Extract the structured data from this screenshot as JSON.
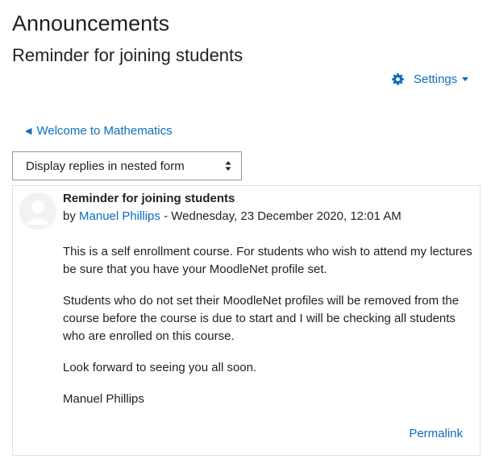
{
  "page": {
    "title": "Announcements",
    "discussion_title": "Reminder for joining students"
  },
  "settings_menu": {
    "label": "Settings",
    "icon": "gear-icon",
    "accent_color": "#0f6cbf"
  },
  "navigation": {
    "back_link_label": "Welcome to Mathematics"
  },
  "display_mode": {
    "selected": "Display replies in nested form"
  },
  "post": {
    "subject": "Reminder for joining students",
    "by_prefix": "by",
    "author": "Manuel Phillips",
    "date_separator": " - ",
    "date": "Wednesday, 23 December 2020, 12:01 AM",
    "paragraphs": [
      "This is a self enrollment course. For students who wish to attend my lectures be sure that you have your MoodleNet profile set.",
      "Students who do not set their MoodleNet profiles will be  removed from the course before the course is due to start and I will be checking all students who are enrolled on this course.",
      "Look forward to seeing you all soon.",
      "Manuel Phillips"
    ],
    "permalink_label": "Permalink"
  }
}
